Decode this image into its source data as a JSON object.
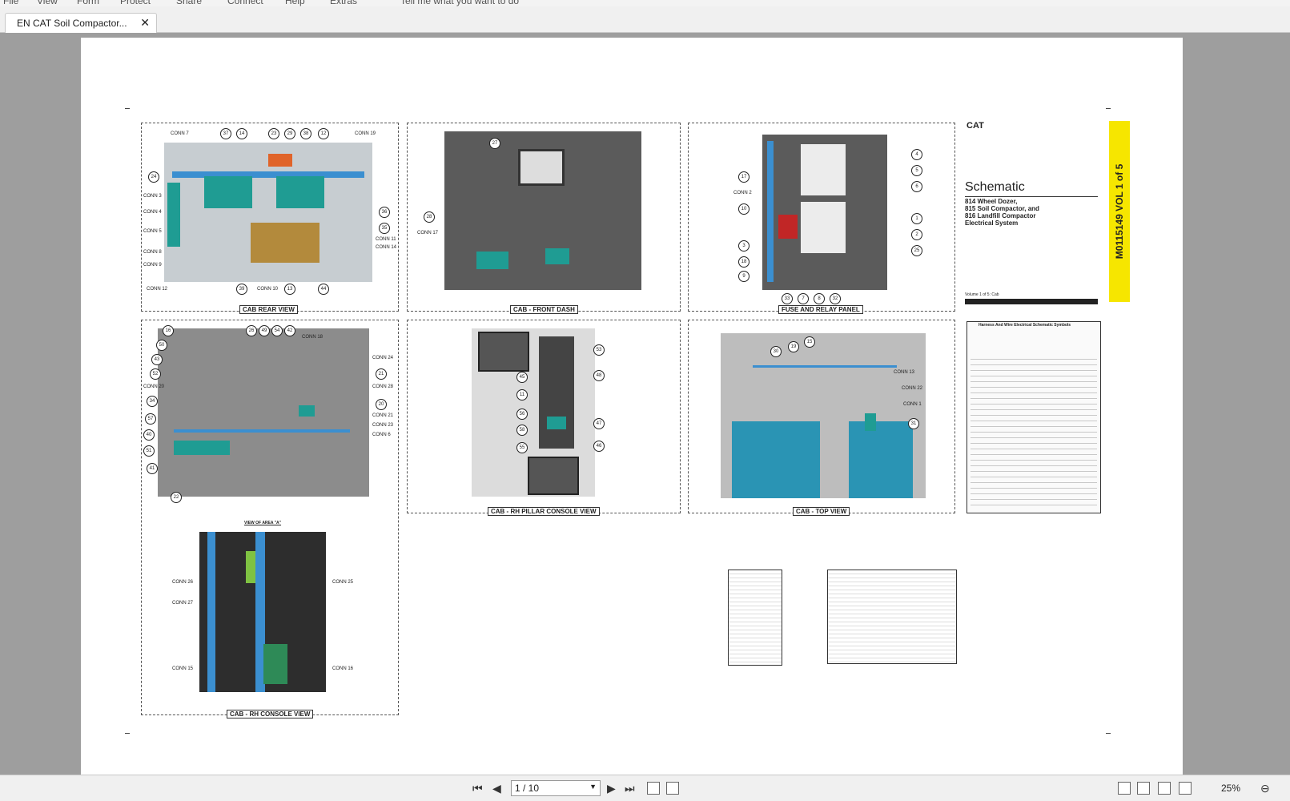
{
  "menu": [
    "File",
    "View",
    "Form",
    "Protect",
    "Share",
    "Connect",
    "Help",
    "Extras",
    "Tell me what you want to do"
  ],
  "tab": {
    "title": "EN CAT Soil Compactor...",
    "close": "✕"
  },
  "document": {
    "panels": [
      {
        "caption": "CAB REAR VIEW"
      },
      {
        "caption": "CAB - FRONT DASH"
      },
      {
        "caption": "FUSE AND RELAY PANEL"
      },
      {
        "caption": "CAB - RH PILLAR CONSOLE VIEW"
      },
      {
        "caption": "CAB - TOP VIEW"
      },
      {
        "caption": "CAB - RH CONSOLE VIEW"
      }
    ],
    "view_note": "VIEW OF AREA \"A\"",
    "rear_labels": [
      "CONN 7",
      "CONN 19",
      "CONN 3",
      "CONN 4",
      "CONN 5",
      "CONN 8",
      "CONN 9",
      "CONN 12",
      "CONN 10",
      "CONN 11",
      "CONN 14"
    ],
    "rear_callouts": [
      "37",
      "14",
      "23",
      "29",
      "38",
      "12",
      "24",
      "36",
      "35",
      "39",
      "13",
      "44"
    ],
    "dash_labels": [
      "CONN 17"
    ],
    "dash_callouts": [
      "27",
      "28"
    ],
    "fuse_labels": [
      "CONN 2"
    ],
    "fuse_callouts": [
      "17",
      "10",
      "3",
      "18",
      "9",
      "4",
      "5",
      "6",
      "1",
      "2",
      "25",
      "33",
      "7",
      "8",
      "32"
    ],
    "rh_labels": [
      "CONN 18",
      "CONN 24",
      "CONN 28",
      "CONN 21",
      "CONN 23",
      "CONN 6",
      "CONN 20"
    ],
    "rh_callouts": [
      "16",
      "50",
      "43",
      "52",
      "34",
      "57",
      "40",
      "51",
      "41",
      "22",
      "26",
      "49",
      "54",
      "42",
      "21",
      "20"
    ],
    "pillar_callouts": [
      "53",
      "45",
      "48",
      "11",
      "56",
      "58",
      "55",
      "47",
      "46"
    ],
    "top_labels": [
      "CONN 13",
      "CONN 22",
      "CONN 1"
    ],
    "top_callouts": [
      "30",
      "19",
      "15",
      "31"
    ],
    "console_labels": [
      "CONN 26",
      "CONN 27",
      "CONN 15",
      "CONN 25",
      "CONN 16"
    ],
    "title_block": {
      "logo": "CAT",
      "heading": "Schematic",
      "line1": "814 Wheel Dozer,",
      "line2": "815 Soil Compactor, and",
      "line3": "816 Landfill Compactor",
      "line4": "Electrical System",
      "volume_note": "Volume 1 of 5: Cab",
      "vol_strip": "M0115149 VOL 1 of 5"
    },
    "symbols_title": "Harness And Wire Electrical Schematic Symbols"
  },
  "nav": {
    "page": "1 / 10",
    "zoom": "25%"
  },
  "colors": {
    "teal": "#1f9c93",
    "wire_blue": "#3b8fd0",
    "vol_yellow": "#f6e600"
  }
}
